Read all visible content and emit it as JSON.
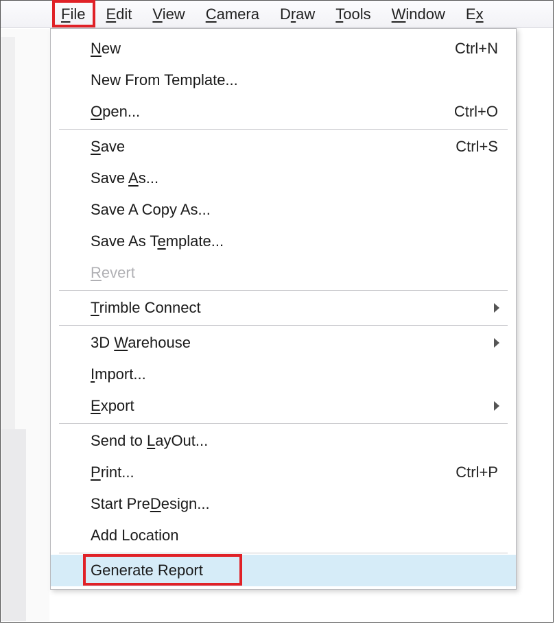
{
  "menubar": {
    "items": [
      {
        "pre": "",
        "ul": "F",
        "post": "ile"
      },
      {
        "pre": "",
        "ul": "E",
        "post": "dit"
      },
      {
        "pre": "",
        "ul": "V",
        "post": "iew"
      },
      {
        "pre": "",
        "ul": "C",
        "post": "amera"
      },
      {
        "pre": "D",
        "ul": "r",
        "post": "aw"
      },
      {
        "pre": "",
        "ul": "T",
        "post": "ools"
      },
      {
        "pre": "",
        "ul": "W",
        "post": "indow"
      },
      {
        "pre": "E",
        "ul": "x",
        "post": ""
      }
    ]
  },
  "menu": {
    "sections": [
      [
        {
          "id": "new",
          "pre": "",
          "ul": "N",
          "post": "ew",
          "shortcut": "Ctrl+N"
        },
        {
          "id": "new-template",
          "pre": "New From Template...",
          "ul": "",
          "post": ""
        },
        {
          "id": "open",
          "pre": "",
          "ul": "O",
          "post": "pen...",
          "shortcut": "Ctrl+O"
        }
      ],
      [
        {
          "id": "save",
          "pre": "",
          "ul": "S",
          "post": "ave",
          "shortcut": "Ctrl+S"
        },
        {
          "id": "save-as",
          "pre": "Save ",
          "ul": "A",
          "post": "s..."
        },
        {
          "id": "save-copy",
          "pre": "Save A Copy As...",
          "ul": "",
          "post": ""
        },
        {
          "id": "save-template",
          "pre": "Save As T",
          "ul": "e",
          "post": "mplate..."
        },
        {
          "id": "revert",
          "pre": "",
          "ul": "R",
          "post": "evert",
          "disabled": true
        }
      ],
      [
        {
          "id": "trimble",
          "pre": "",
          "ul": "T",
          "post": "rimble Connect",
          "submenu": true
        }
      ],
      [
        {
          "id": "warehouse",
          "pre": "3D ",
          "ul": "W",
          "post": "arehouse",
          "submenu": true
        },
        {
          "id": "import",
          "pre": "",
          "ul": "I",
          "post": "mport..."
        },
        {
          "id": "export",
          "pre": "",
          "ul": "E",
          "post": "xport",
          "submenu": true
        }
      ],
      [
        {
          "id": "layout",
          "pre": "Send to ",
          "ul": "L",
          "post": "ayOut..."
        },
        {
          "id": "print",
          "pre": "",
          "ul": "P",
          "post": "rint...",
          "shortcut": "Ctrl+P"
        },
        {
          "id": "predesign",
          "pre": "Start Pre",
          "ul": "D",
          "post": "esign..."
        },
        {
          "id": "add-location",
          "pre": "Add Location",
          "ul": "",
          "post": ""
        }
      ],
      [
        {
          "id": "generate-report",
          "pre": "Generate Report",
          "ul": "",
          "post": "",
          "hovered": true
        }
      ]
    ]
  }
}
